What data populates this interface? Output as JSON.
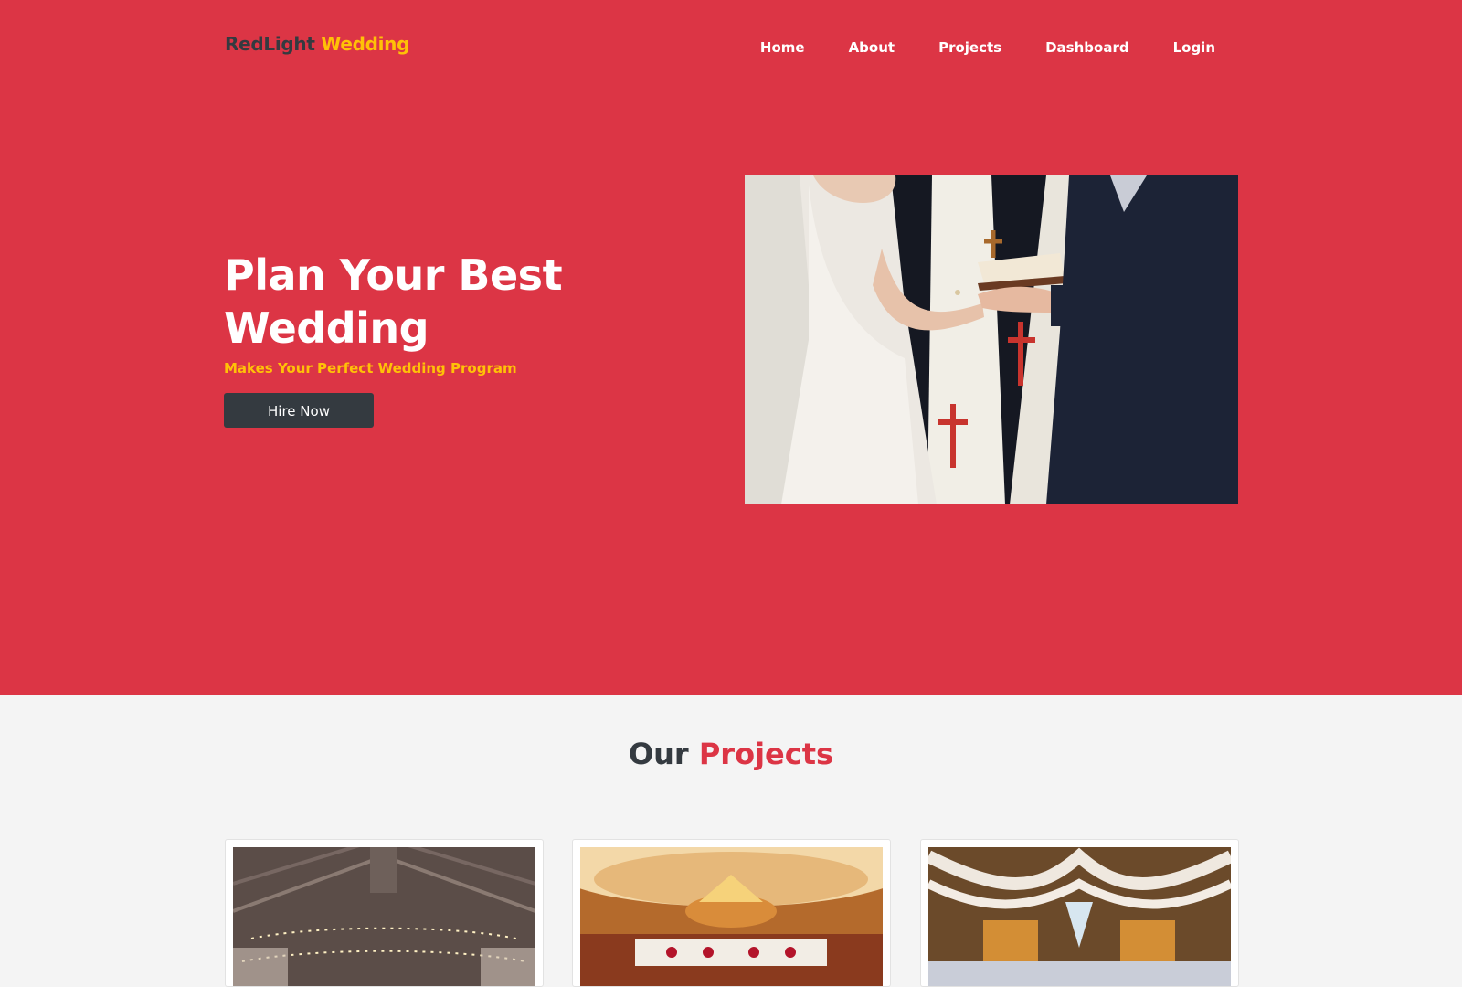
{
  "brand": {
    "name_part1": "RedLight",
    "name_part2": "Wedding",
    "accent_color": "#ffc107"
  },
  "nav": {
    "items": [
      {
        "label": "Home"
      },
      {
        "label": "About"
      },
      {
        "label": "Projects"
      },
      {
        "label": "Dashboard"
      },
      {
        "label": "Login"
      }
    ]
  },
  "hero": {
    "title": "Plan Your Best Wedding",
    "subtitle": "Makes Your Perfect Wedding Program",
    "cta_label": "Hire Now",
    "background_color": "#dc3545"
  },
  "projects": {
    "title_part1": "Our",
    "title_part2": "Projects",
    "cards": [
      {
        "image": "barn-string-lights-photo"
      },
      {
        "image": "banquet-hall-chandelier-photo"
      },
      {
        "image": "rustic-barn-drapes-photo"
      }
    ]
  }
}
